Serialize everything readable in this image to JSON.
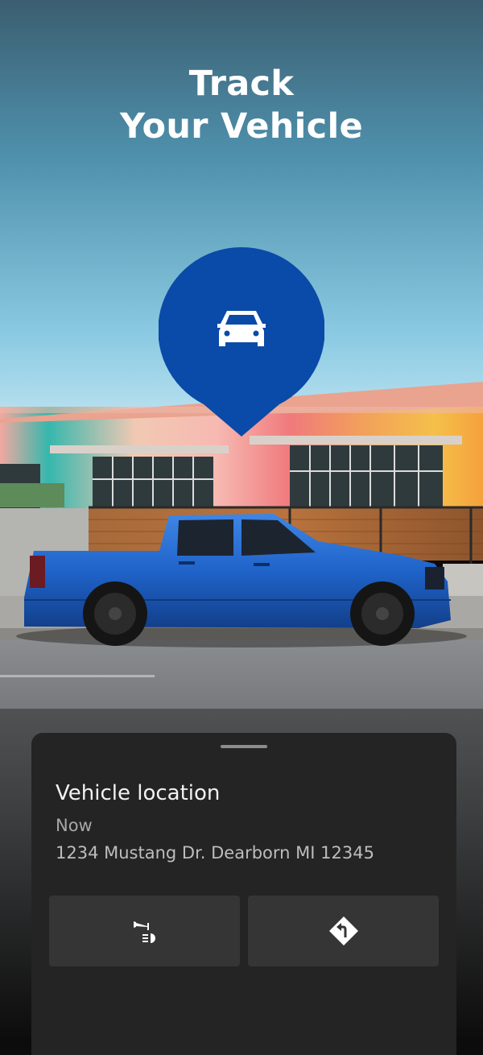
{
  "hero": {
    "title_line1": "Track",
    "title_line2": "Your Vehicle"
  },
  "map_pin": {
    "icon": "car-front-icon",
    "color": "#0a4aa8"
  },
  "location_sheet": {
    "title": "Vehicle location",
    "time": "Now",
    "address": "1234 Mustang Dr. Dearborn MI 12345",
    "actions": [
      {
        "icon": "horn-lights-icon"
      },
      {
        "icon": "directions-icon"
      }
    ]
  },
  "colors": {
    "sky_top": "#3d6275",
    "sky_bottom": "#bfe6f4",
    "truck": "#1f63c9",
    "sheet_bg": "#242424",
    "button_bg": "#353535"
  }
}
